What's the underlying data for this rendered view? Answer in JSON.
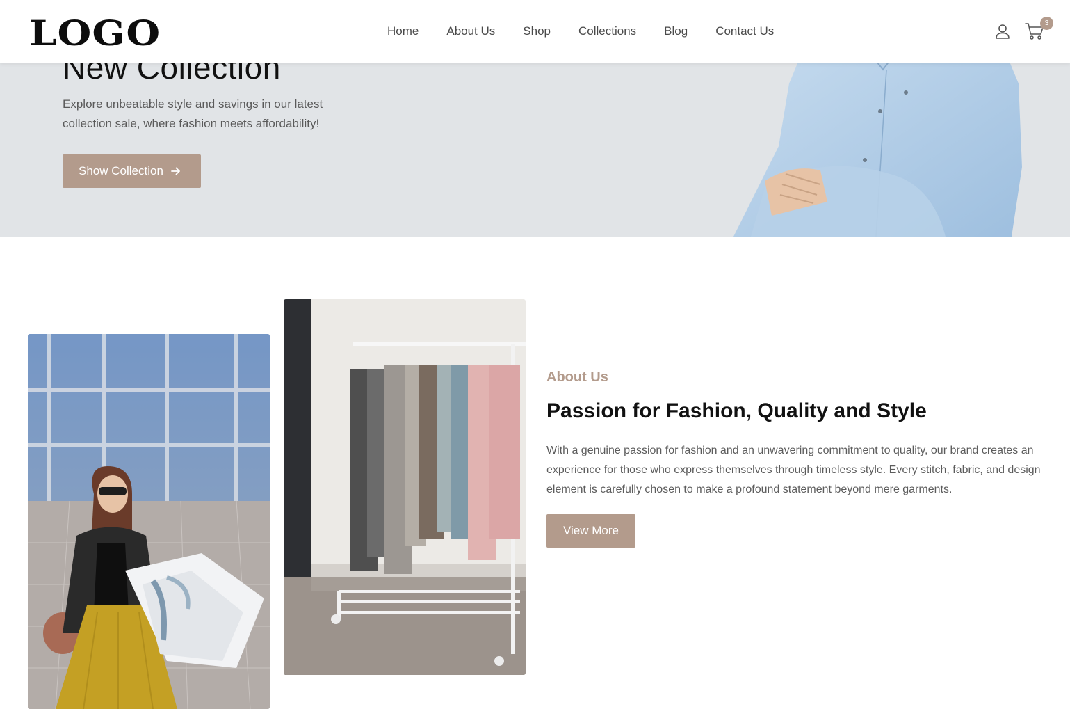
{
  "navbar": {
    "logo": "LOGO",
    "links": [
      "Home",
      "About Us",
      "Shop",
      "Collections",
      "Blog",
      "Contact Us"
    ],
    "user_icon": "user-icon",
    "cart_icon": "cart-icon",
    "cart_count": "3"
  },
  "hero": {
    "title": "New Collection",
    "description": "Explore unbeatable style and savings in our latest collection sale, where fashion meets affordability!",
    "button_label": "Show Collection",
    "button_icon": "arrow-right-icon",
    "background_color": "#e1e4e7"
  },
  "about": {
    "eyebrow": "About Us",
    "title": "Passion for Fashion, Quality and Style",
    "text": "With a genuine passion for fashion and an unwavering commitment to quality, our brand creates an experience for those who express themselves through timeless style. Every stitch, fabric, and design element is carefully chosen to make a profound statement beyond mere garments.",
    "button_label": "View More"
  },
  "colors": {
    "accent": "#b39b8c",
    "heading": "#111111",
    "body_text": "#5c5c5c"
  }
}
